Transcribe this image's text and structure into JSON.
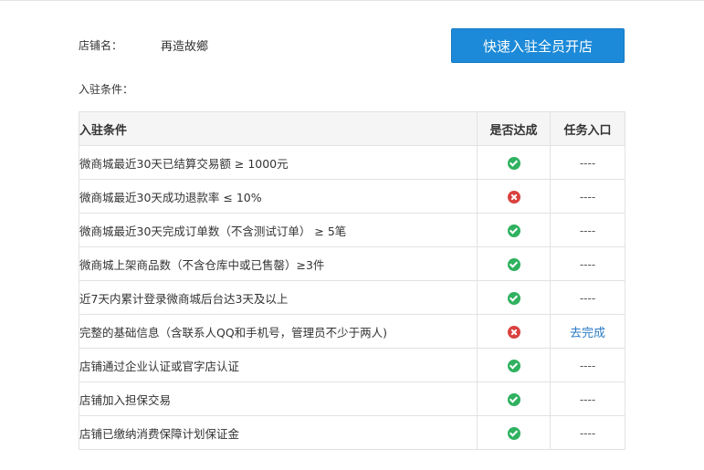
{
  "store": {
    "label": "店铺名：",
    "name": "再造故鄉"
  },
  "join_button": {
    "label": "快速入驻全员开店"
  },
  "conditions_label": "入驻条件：",
  "table": {
    "headers": {
      "condition": "入驻条件",
      "achieved": "是否达成",
      "task": "任务入口"
    },
    "rows": [
      {
        "condition": "微商城最近30天已结算交易额 ≥ 1000元",
        "achieved": true,
        "task": "----"
      },
      {
        "condition": "微商城最近30天成功退款率 ≤ 10%",
        "achieved": false,
        "task": "----"
      },
      {
        "condition": "微商城最近30天完成订单数（不含测试订单） ≥ 5笔",
        "achieved": true,
        "task": "----"
      },
      {
        "condition": "微商城上架商品数（不含仓库中或已售罄）≥3件",
        "achieved": true,
        "task": "----"
      },
      {
        "condition": "近7天内累计登录微商城后台达3天及以上",
        "achieved": true,
        "task": "----"
      },
      {
        "condition": "完整的基础信息（含联系人QQ和手机号，管理员不少于两人)",
        "achieved": false,
        "task": "去完成",
        "task_link": true
      },
      {
        "condition": "店铺通过企业认证或官字店认证",
        "achieved": true,
        "task": "----"
      },
      {
        "condition": "店铺加入担保交易",
        "achieved": true,
        "task": "----"
      },
      {
        "condition": "店铺已缴纳消费保障计划保证金",
        "achieved": true,
        "task": "----"
      }
    ]
  },
  "icons": {
    "achieved": "check-circle-icon",
    "not_achieved": "x-circle-icon"
  },
  "colors": {
    "button": "#1c8ad8",
    "success": "#2fb15f",
    "fail": "#d9423f",
    "link": "#2a7bc4"
  }
}
